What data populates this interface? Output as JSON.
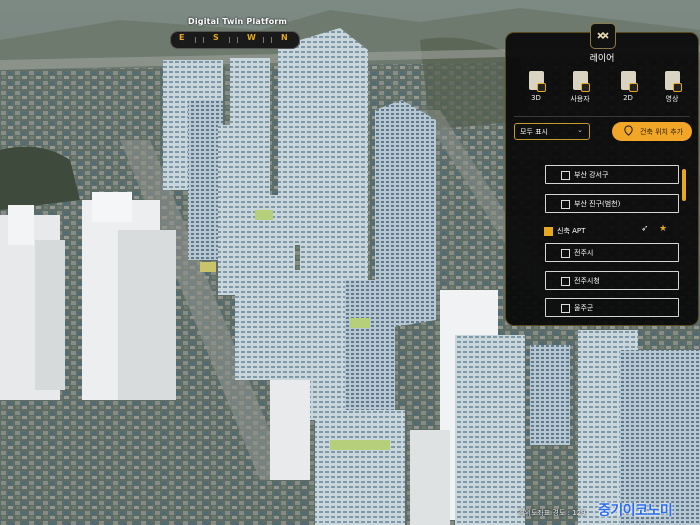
{
  "platform": {
    "title": "Digital Twin Platform"
  },
  "compass": {
    "e": "E",
    "s": "S",
    "w": "W",
    "n": "N"
  },
  "panel": {
    "title": "레이어",
    "tabs": [
      {
        "label": "3D",
        "icon": "3d-layer-icon"
      },
      {
        "label": "사용자",
        "icon": "user-layer-icon"
      },
      {
        "label": "2D",
        "icon": "2d-layer-icon"
      },
      {
        "label": "영상",
        "icon": "video-layer-icon"
      }
    ],
    "dropdown": {
      "selected": "모두 표시"
    },
    "add_button": "건축 위치 추가",
    "items": [
      {
        "label": "부산 강서구",
        "active": false
      },
      {
        "label": "부산 진구(범천)",
        "active": false
      },
      {
        "label": "신축 APT",
        "active": true
      },
      {
        "label": "전주시",
        "active": false
      },
      {
        "label": "전주시청",
        "active": false
      },
      {
        "label": "울주군",
        "active": false
      }
    ]
  },
  "status": {
    "coords": "경위도좌표 경도 : 129"
  },
  "watermark": "중기이코노미",
  "colors": {
    "accent": "#e6a81e",
    "panel_bg": "#0a0a0a",
    "watermark": "#2b6df0"
  }
}
